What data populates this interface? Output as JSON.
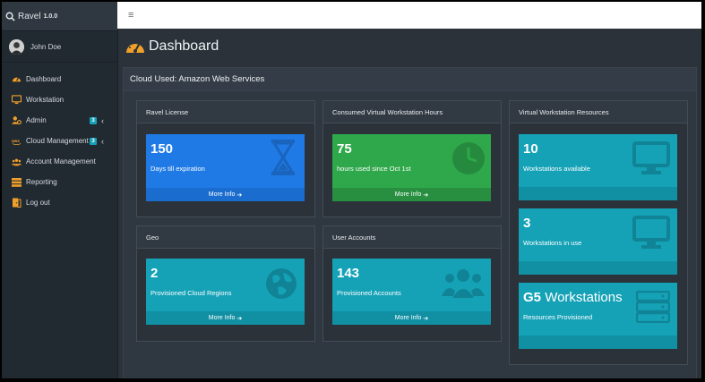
{
  "app": {
    "name": "Ravel",
    "version": "1.0.0"
  },
  "user": {
    "name": "John Doe"
  },
  "sidebar": {
    "items": [
      {
        "label": "Dashboard",
        "icon": "tachometer-icon"
      },
      {
        "label": "Workstation",
        "icon": "monitor-icon"
      },
      {
        "label": "Admin",
        "icon": "user-cog-icon",
        "badge": "3"
      },
      {
        "label": "Cloud Management",
        "icon": "aws-icon",
        "badge": "3"
      },
      {
        "label": "Account Management",
        "icon": "users-icon"
      },
      {
        "label": "Reporting",
        "icon": "table-icon"
      },
      {
        "label": "Log out",
        "icon": "door-icon"
      }
    ]
  },
  "page": {
    "title": "Dashboard"
  },
  "main": {
    "title": "Cloud Used: Amazon Web Services",
    "boxes": {
      "license": {
        "title": "Ravel License",
        "value": "150",
        "label": "Days till expiration",
        "footer": "More Info"
      },
      "hours": {
        "title": "Consumed Virtual Workstation Hours",
        "value": "75",
        "label": "hours used since Oct 1st",
        "footer": "More Info"
      },
      "geo": {
        "title": "Geo",
        "value": "2",
        "label": "Provisioned Cloud Regions",
        "footer": "More Info"
      },
      "accounts": {
        "title": "User Accounts",
        "value": "143",
        "label": "Provisioned Accounts",
        "footer": "More Info"
      },
      "resources": {
        "title": "Virtual Workstation Resources",
        "available": {
          "value": "10",
          "label": "Workstations available"
        },
        "inuse": {
          "value": "3",
          "label": "Workstations in use"
        },
        "provisioned": {
          "value": "G5",
          "value_suffix": "Workstations",
          "label": "Resources Provisioned"
        }
      }
    }
  },
  "colors": {
    "blue": "#1f7ae6",
    "green": "#2fa84b",
    "teal": "#15a2b7",
    "sidebar": "#222a31",
    "accent": "#f0a02a"
  }
}
